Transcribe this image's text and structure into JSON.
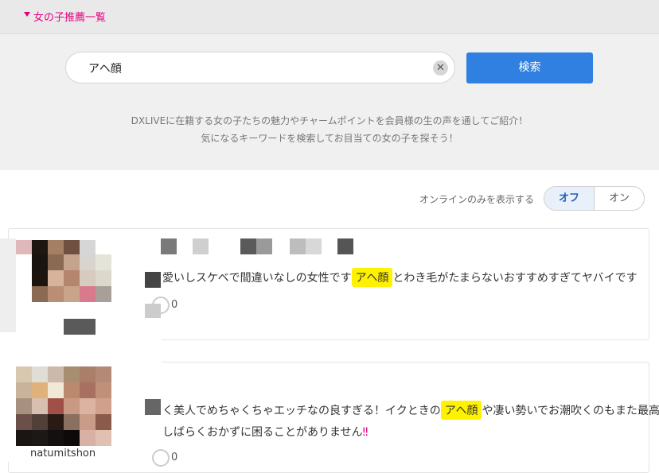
{
  "header": {
    "title": "女の子推薦一覧"
  },
  "search": {
    "value": "アヘ顔",
    "clear_icon": "close-icon",
    "button_label": "検索",
    "description_line1": "DXLIVEに在籍する女の子たちの魅力やチャームポイントを会員様の生の声を通してご紹介！",
    "description_line2": "気になるキーワードを検索してお目当ての女の子を探そう！"
  },
  "filter": {
    "online_label": "オンラインのみを表示する",
    "off_label": "オフ",
    "on_label": "オン",
    "selected": "オフ"
  },
  "results": [
    {
      "comment_before": "愛いしスケベで間違いなしの女性です",
      "keyword": "アヘ顔",
      "comment_after": "とわき毛がたまらないおすすめすぎてヤバイです",
      "likes": "0"
    },
    {
      "username": "natumitshon",
      "comment_before": "く美人でめちゃくちゃエッチなの良すぎる！イクときの",
      "keyword": "アヘ顔",
      "comment_after": "や凄い勢いでお潮吹くのもまた最高",
      "comment_line2": "しばらくおかずに困ることがありません",
      "comment_line2_emoji": "‼",
      "likes": "0"
    }
  ],
  "colors": {
    "accent": "#e4007f",
    "button": "#2f80e0",
    "highlight": "#fff200"
  }
}
